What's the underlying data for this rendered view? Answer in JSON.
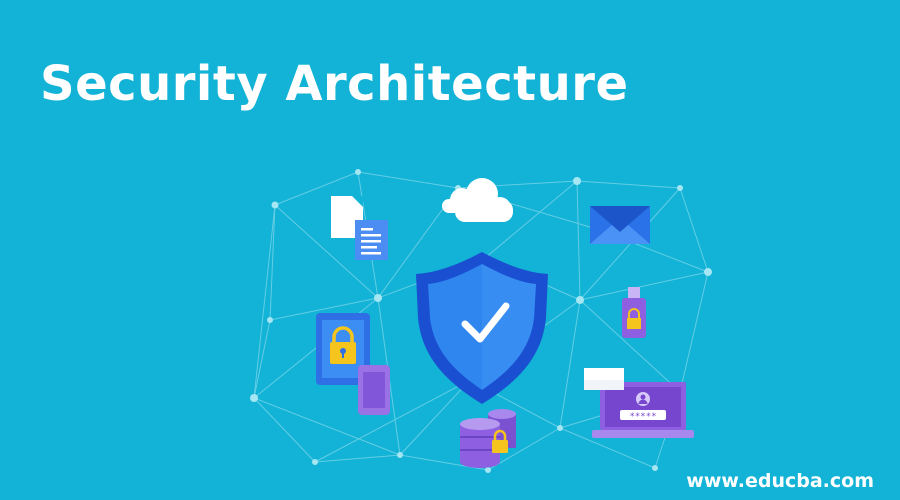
{
  "banner": {
    "title": "Security Architecture",
    "website": "www.educba.com",
    "password_mask": "*****"
  },
  "icons": [
    "document-icon",
    "cloud-icon",
    "envelope-icon",
    "usb-lock-icon",
    "tablet-lock-icon",
    "phone-icon",
    "shield-check-icon",
    "database-lock-icon",
    "laptop-login-icon",
    "chat-bubble-icon"
  ],
  "colors": {
    "background": "#12b3d6",
    "shield_dark": "#1a4fd1",
    "shield_light": "#2f86ef",
    "purple": "#8e5fe0",
    "lock_yellow": "#f6c51d",
    "network_line": "#7fd6ea"
  }
}
